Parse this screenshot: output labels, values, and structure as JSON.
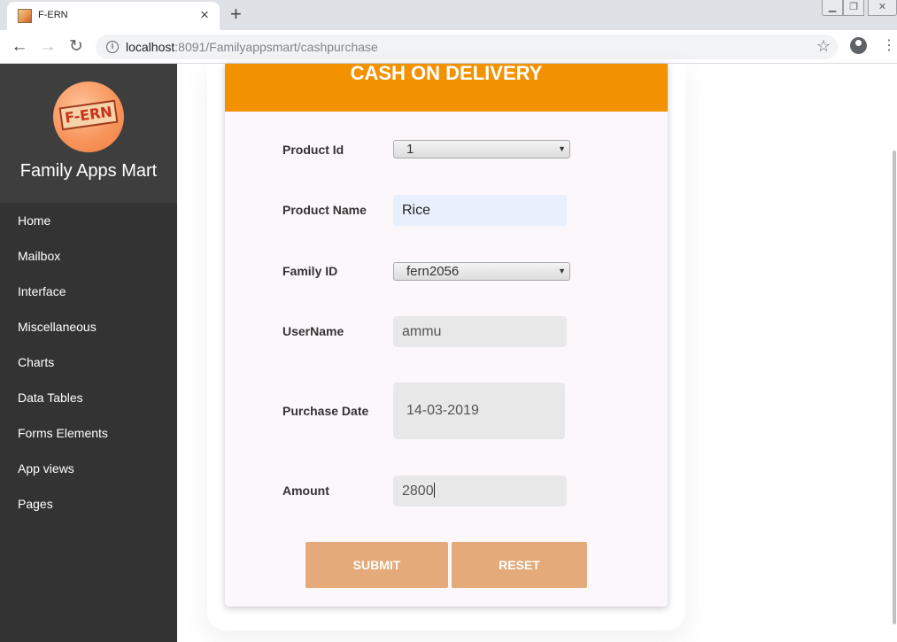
{
  "browser": {
    "tab_title": "F-ERN",
    "url_host": "localhost",
    "url_path": ":8091/Familyappsmart/cashpurchase",
    "icons": [
      "back-arrow-icon",
      "forward-arrow-icon",
      "reload-icon",
      "info-icon",
      "star-icon",
      "account-icon",
      "more-menu-icon"
    ]
  },
  "sidebar": {
    "logo_text": "F-ERN",
    "brand": "Family Apps Mart",
    "items": [
      {
        "label": "Home"
      },
      {
        "label": "Mailbox"
      },
      {
        "label": "Interface"
      },
      {
        "label": "Miscellaneous"
      },
      {
        "label": "Charts"
      },
      {
        "label": "Data Tables"
      },
      {
        "label": "Forms Elements"
      },
      {
        "label": "App views"
      },
      {
        "label": "Pages"
      }
    ]
  },
  "form": {
    "title": "CASH ON DELIVERY",
    "product_id": {
      "label": "Product Id",
      "value": "1"
    },
    "product_name": {
      "label": "Product Name",
      "value": "Rice"
    },
    "family_id": {
      "label": "Family ID",
      "value": "fern2056"
    },
    "username": {
      "label": "UserName",
      "value": "ammu"
    },
    "purchase_date": {
      "label": "Purchase Date",
      "value": "14-03-2019"
    },
    "amount": {
      "label": "Amount",
      "value": "2800"
    },
    "submit_label": "SUBMIT",
    "reset_label": "RESET"
  },
  "colors": {
    "header": "#f29200",
    "buttons": "#e5aa7a",
    "sidebar": "#333333"
  }
}
